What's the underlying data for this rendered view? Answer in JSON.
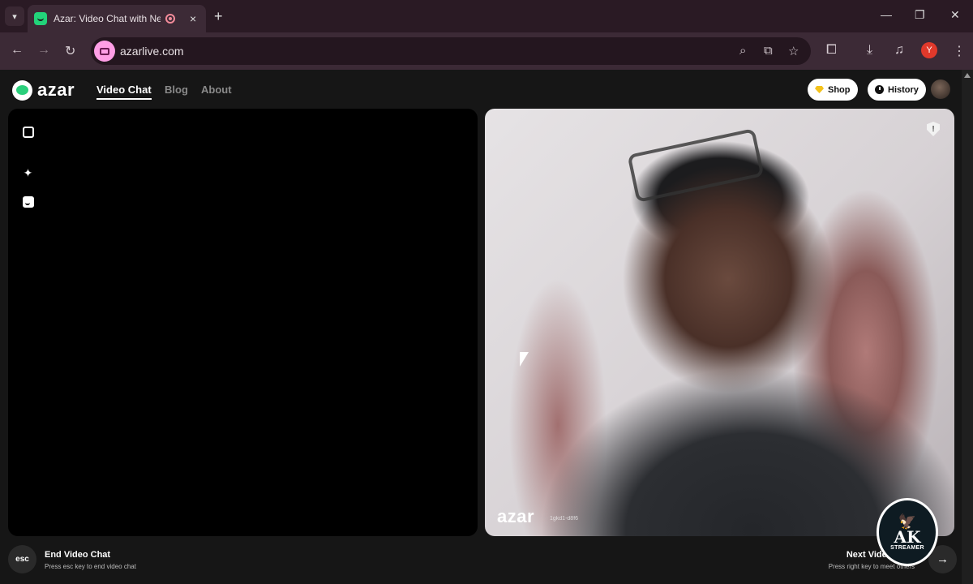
{
  "browser": {
    "tab_title": "Azar: Video Chat with New People",
    "tab_close": "×",
    "new_tab": "+",
    "url": "azarlive.com",
    "profile_initial": "Y",
    "window_controls": [
      "—",
      "❐",
      "✕"
    ],
    "nav_icons": [
      "←",
      "→",
      "↻"
    ],
    "omnibox_icons": [
      "zoom-icon",
      "install-app-icon",
      "bookmark-star-icon"
    ],
    "toolbar_icons": [
      "extensions-icon",
      "downloads-icon",
      "media-control-icon",
      "menu-icon"
    ]
  },
  "header": {
    "logo_text": "azar",
    "nav": [
      {
        "label": "Video Chat",
        "active": true
      },
      {
        "label": "Blog",
        "active": false
      },
      {
        "label": "About",
        "active": false
      }
    ],
    "shop_label": "Shop",
    "history_label": "History"
  },
  "left_panel": {
    "tools": [
      "expand-icon",
      "sparkle-effects-icon",
      "sticker-face-icon"
    ]
  },
  "right_panel": {
    "watermark_logo": "azar",
    "watermark_id": "1gkd1-d8f6",
    "report_symbol": "!"
  },
  "bottom": {
    "esc_label": "esc",
    "end_title": "End Video Chat",
    "end_subtitle": "Press esc key to end video chat",
    "next_title": "Next Video Chat",
    "next_subtitle": "Press right key to meet others",
    "next_arrow": "→"
  },
  "overlay_badge": {
    "big": "AK",
    "small": "STREAMER"
  },
  "colors": {
    "accent": "#2bd07c",
    "tab_bar": "#2a1a24",
    "toolbar": "#3c2a36",
    "page_bg": "#161616",
    "gem": "#f4c21a"
  }
}
